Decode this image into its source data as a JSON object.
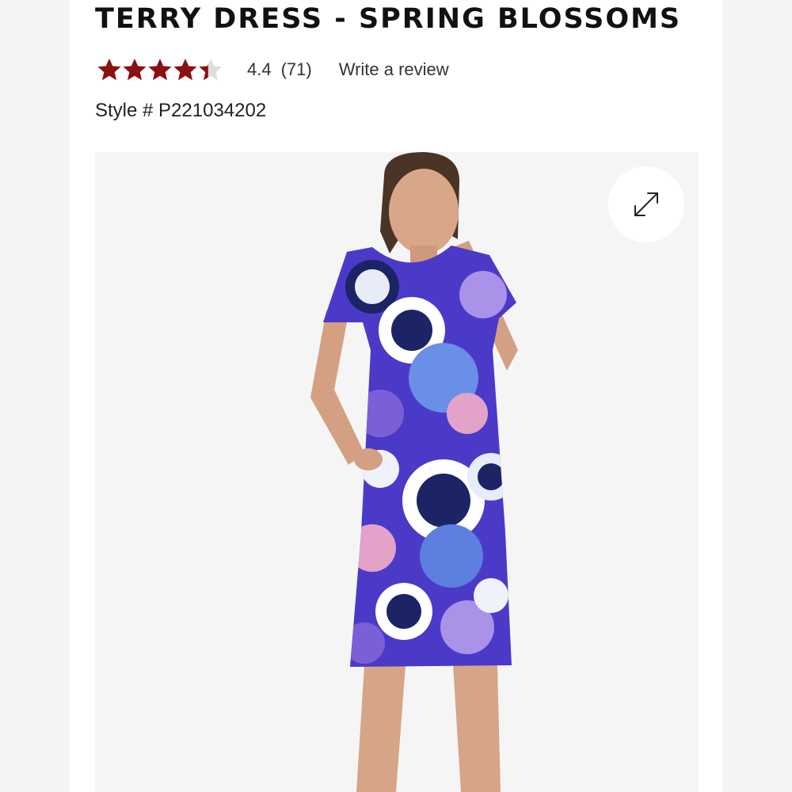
{
  "product": {
    "title": "TERRY DRESS - SPRING BLOSSOMS",
    "rating": {
      "stars_value": 4.4,
      "stars_max": 5,
      "value_text": "4.4",
      "count_text": "(71)",
      "write_review_label": "Write a review",
      "star_color": "#8b1012",
      "star_empty_color": "#dddddd"
    },
    "style_line": "Style # P221034202"
  },
  "image": {
    "expand_icon": "expand-arrows-icon",
    "background_color": "#f5f5f5"
  }
}
